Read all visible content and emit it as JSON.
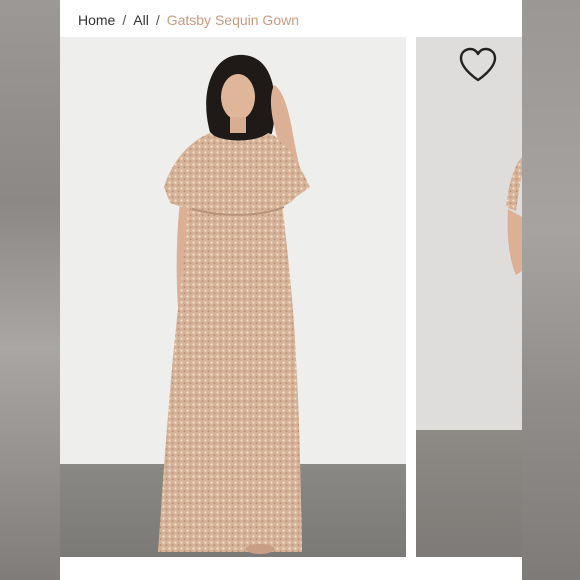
{
  "breadcrumb": {
    "home": "Home",
    "all": "All",
    "current": "Gatsby Sequin Gown",
    "separator": "/"
  },
  "icons": {
    "wishlist": "heart-outline-icon"
  },
  "colors": {
    "breadcrumb_current": "#c99b80",
    "dress": "#d8b49b"
  }
}
